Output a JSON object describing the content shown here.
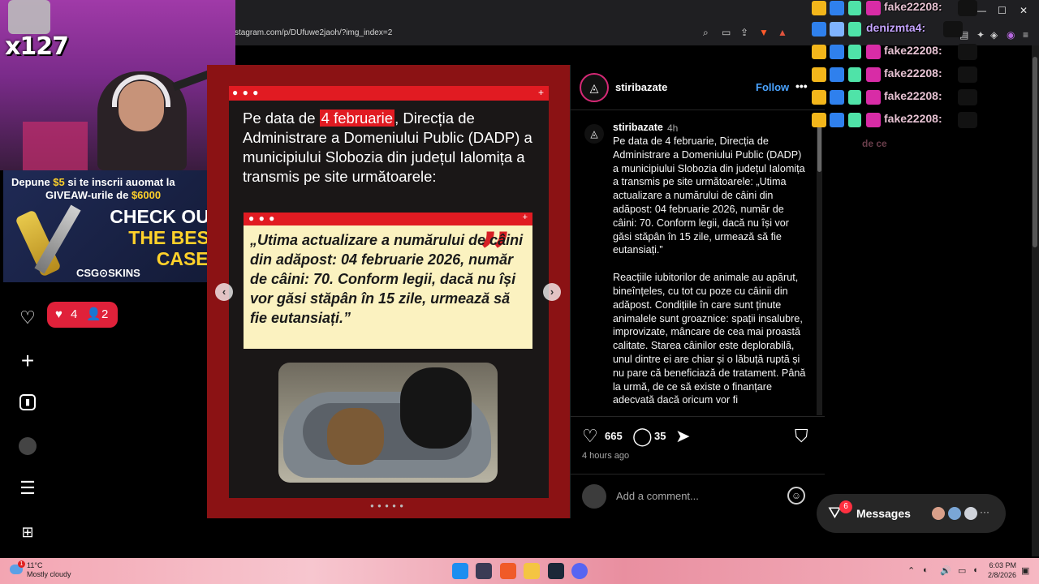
{
  "browser": {
    "url": "stagram.com/p/DUfuwe2jaoh/?img_index=2",
    "window_controls": [
      "—",
      "☐",
      "✕"
    ]
  },
  "stream": {
    "overlay_counter": "x127",
    "ad": {
      "line1_pre": "Depune ",
      "line1_amount": "$5",
      "line1_post": " si te inscrii auomat la",
      "line2_pre": "GIVEAW",
      "line2_mid": "-urile de ",
      "line2_amount": "$6000",
      "cta_line1": "CHECK OUT",
      "cta_line2": "THE BEST",
      "cta_line3": "CASES",
      "brand": "CSG⊙SKINS"
    },
    "chat": [
      {
        "name": "fake22208:"
      },
      {
        "name": "denizmta4:"
      },
      {
        "name": "fake22208:"
      },
      {
        "name": "fake22208:"
      },
      {
        "name": "fake22208:"
      },
      {
        "name": "fake22208:"
      }
    ],
    "chat_faded": "de ce"
  },
  "sidebar": {
    "notifications": {
      "likes": "4",
      "follows": "2"
    }
  },
  "post": {
    "headline_pre": "Pe data de ",
    "headline_date": "4 februarie",
    "headline_post": ", Direcția de Administrare a Domeniului Public (DADP) a municipiului Slobozia din județul Ialomița a transmis pe site următoarele:",
    "quote": "„Utima actualizare a numărului de câini din adăpost: 04 februarie 2026, număr de câini: 70. Conform legii, dacă nu își vor găsi stăpân în 15 zile, urmează să fie eutansiați.”",
    "quote_mark": "”",
    "prev_label": "‹",
    "next_label": "›",
    "pager": "● ● ● ● ●",
    "card_dots": "● ● ●",
    "card_plus": "+"
  },
  "panel": {
    "username": "stiribazate",
    "follow_label": "Follow",
    "more_label": "•••",
    "caption_user": "stiribazate",
    "caption_time": "4h",
    "caption_p1": "Pe data de 4 februarie, Direcția de Administrare a Domeniului Public (DADP) a municipiului Slobozia din județul Ialomița a transmis pe site următoarele: „Utima actualizare a numărului de câini din adăpost: 04 februarie 2026, număr de câini: 70. Conform legii, dacă nu își vor găsi stăpân în 15 zile, urmează să fie eutansiați.”",
    "caption_p2": "Reacțiile iubitorilor de animale au apărut, bineînțeles, cu tot cu poze cu câinii din adăpost. Condițiile în care sunt ținute animalele sunt groaznice: spații insalubre, improvizate, mâncare de cea mai proastă calitate. Starea câinilor este deplorabilă, unul dintre ei are chiar și o lăbuță ruptă și nu pare că beneficiază de tratament. Până la urmă, de ce să existe o finanțare adecvată dacă oricum vor fi",
    "likes": "665",
    "comments": "35",
    "time_ago": "4 hours ago",
    "comment_placeholder": "Add a comment..."
  },
  "messages": {
    "label": "Messages",
    "badge": "6",
    "more": "···"
  },
  "taskbar": {
    "temperature": "11°C",
    "weather": "Mostly cloudy",
    "time": "6:03 PM",
    "date": "2/8/2026",
    "weather_badge": "1"
  },
  "colors": {
    "instagram_red": "#e11b22",
    "follow_blue": "#4aa3ff",
    "notification_red": "#e0213a",
    "quote_bg": "#fbf2c0"
  }
}
